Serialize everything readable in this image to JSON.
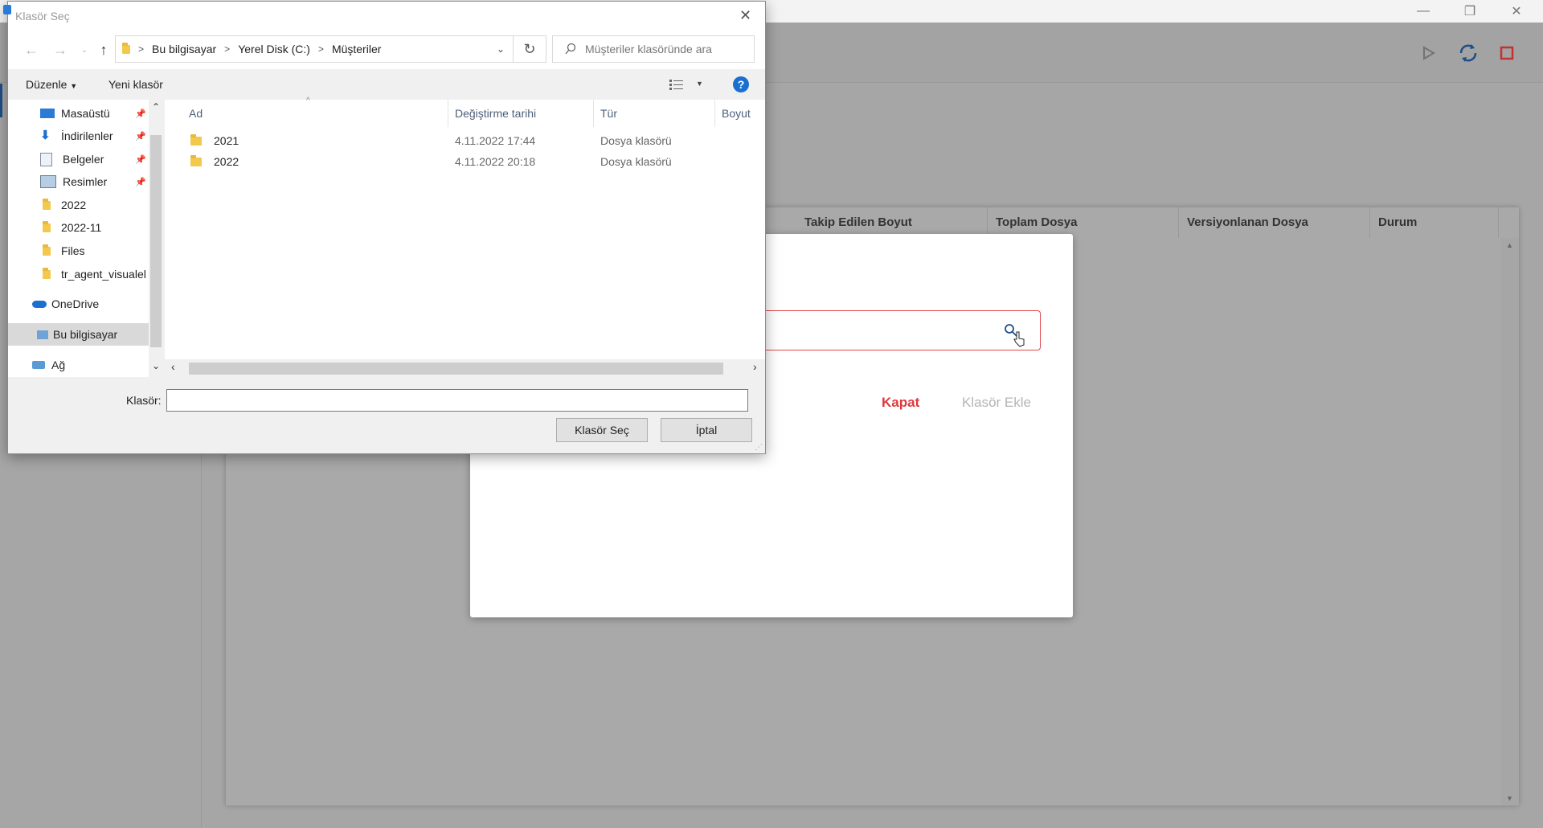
{
  "app": {
    "table_headers": [
      "Takip Edilen Boyut",
      "Toplam Dosya",
      "Versiyonlanan Dosya",
      "Durum"
    ]
  },
  "modal": {
    "close_label": "Kapat",
    "add_label": "Klasör Ekle"
  },
  "dialog": {
    "title": "Klasör Seç",
    "breadcrumb": [
      "Bu bilgisayar",
      "Yerel Disk (C:)",
      "Müşteriler"
    ],
    "search_placeholder": "Müşteriler klasöründe ara",
    "organize_label": "Düzenle",
    "new_folder_label": "Yeni klasör",
    "nav_items": [
      {
        "label": "Masaüstü",
        "icon": "desktop-icon",
        "pinned": true
      },
      {
        "label": "İndirilenler",
        "icon": "download-icon",
        "pinned": true
      },
      {
        "label": "Belgeler",
        "icon": "documents-icon",
        "pinned": true
      },
      {
        "label": "Resimler",
        "icon": "pictures-icon",
        "pinned": true
      },
      {
        "label": "2022",
        "icon": "folder-icon",
        "pinned": false
      },
      {
        "label": "2022-11",
        "icon": "folder-icon",
        "pinned": false
      },
      {
        "label": "Files",
        "icon": "folder-icon",
        "pinned": false
      },
      {
        "label": "tr_agent_visualel",
        "icon": "folder-icon",
        "pinned": false
      },
      {
        "label": "OneDrive",
        "icon": "onedrive-icon",
        "pinned": false
      },
      {
        "label": "Bu bilgisayar",
        "icon": "computer-icon",
        "pinned": false,
        "selected": true
      },
      {
        "label": "Ağ",
        "icon": "network-icon",
        "pinned": false
      }
    ],
    "columns": [
      "Ad",
      "Değiştirme tarihi",
      "Tür",
      "Boyut"
    ],
    "files": [
      {
        "name": "2021",
        "modified": "4.11.2022 17:44",
        "type": "Dosya klasörü",
        "size": ""
      },
      {
        "name": "2022",
        "modified": "4.11.2022 20:18",
        "type": "Dosya klasörü",
        "size": ""
      }
    ],
    "folder_label": "Klasör:",
    "folder_value": "",
    "select_button": "Klasör Seç",
    "cancel_button": "İptal"
  }
}
